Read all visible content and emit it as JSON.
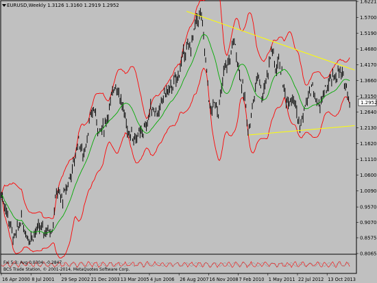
{
  "header": {
    "symbol_label": "EURUSD,Weekly",
    "ohlc_text": "1.3126 1.3160 1.2919 1.2952"
  },
  "indicator_label": "Fxi 5,3: Avg 0.0304: -0.2847",
  "copyright": "BCS Trade Station, © 2001-2014, MetaQuotes Software Corp.",
  "colors": {
    "background": "#c0c0c0",
    "candles": "#000000",
    "bands": "#ff0000",
    "ma": "#00aa00",
    "trendlines": "#ffff00",
    "price_box": "#ffffff"
  },
  "chart_data": {
    "type": "line",
    "ylim": [
      0.8065,
      1.6221
    ],
    "y_ticks": [
      "1.6221",
      "1.5700",
      "1.5190",
      "1.4680",
      "1.4170",
      "1.3660",
      "1.3150",
      "1.2640",
      "1.2130",
      "1.1620",
      "1.1110",
      "1.0600",
      "1.0090",
      "0.9570",
      "0.9070",
      "0.8575",
      "0.8065"
    ],
    "x_labels": [
      "16 Apr 2000",
      "8 Jul 2001",
      "29 Sep 2002",
      "21 Dec 2003",
      "13 Mar 2005",
      "4 Jun 2006",
      "26 Aug 2007",
      "16 Nov 2008",
      "7 Feb 2010",
      "1 May 2011",
      "22 Jul 2012",
      "13 Oct 2013"
    ],
    "current_price": "1.2952",
    "price_path": [
      [
        2000.29,
        1.0
      ],
      [
        2000.55,
        0.93
      ],
      [
        2000.82,
        0.85
      ],
      [
        2001.1,
        0.92
      ],
      [
        2001.35,
        0.86
      ],
      [
        2001.52,
        0.86
      ],
      [
        2001.85,
        0.89
      ],
      [
        2002.1,
        0.88
      ],
      [
        2002.4,
        0.89
      ],
      [
        2002.55,
        1.01
      ],
      [
        2002.8,
        0.98
      ],
      [
        2002.97,
        1.02
      ],
      [
        2003.25,
        1.09
      ],
      [
        2003.45,
        1.18
      ],
      [
        2003.65,
        1.12
      ],
      [
        2003.85,
        1.2
      ],
      [
        2003.97,
        1.25
      ],
      [
        2004.1,
        1.28
      ],
      [
        2004.3,
        1.2
      ],
      [
        2004.55,
        1.22
      ],
      [
        2004.8,
        1.3
      ],
      [
        2004.95,
        1.36
      ],
      [
        2005.15,
        1.32
      ],
      [
        2005.5,
        1.2
      ],
      [
        2005.85,
        1.18
      ],
      [
        2006.2,
        1.21
      ],
      [
        2006.45,
        1.28
      ],
      [
        2006.8,
        1.26
      ],
      [
        2006.95,
        1.32
      ],
      [
        2007.25,
        1.34
      ],
      [
        2007.55,
        1.38
      ],
      [
        2007.8,
        1.46
      ],
      [
        2008.1,
        1.48
      ],
      [
        2008.3,
        1.56
      ],
      [
        2008.5,
        1.58
      ],
      [
        2008.72,
        1.4
      ],
      [
        2008.88,
        1.26
      ],
      [
        2009.1,
        1.3
      ],
      [
        2009.2,
        1.26
      ],
      [
        2009.45,
        1.4
      ],
      [
        2009.65,
        1.43
      ],
      [
        2009.85,
        1.5
      ],
      [
        2010.1,
        1.38
      ],
      [
        2010.3,
        1.3
      ],
      [
        2010.45,
        1.2
      ],
      [
        2010.6,
        1.28
      ],
      [
        2010.85,
        1.4
      ],
      [
        2011.0,
        1.31
      ],
      [
        2011.3,
        1.42
      ],
      [
        2011.4,
        1.48
      ],
      [
        2011.55,
        1.4
      ],
      [
        2011.7,
        1.44
      ],
      [
        2011.9,
        1.34
      ],
      [
        2012.0,
        1.3
      ],
      [
        2012.3,
        1.32
      ],
      [
        2012.55,
        1.21
      ],
      [
        2012.8,
        1.29
      ],
      [
        2013.05,
        1.35
      ],
      [
        2013.3,
        1.28
      ],
      [
        2013.55,
        1.32
      ],
      [
        2013.85,
        1.37
      ],
      [
        2014.0,
        1.38
      ],
      [
        2014.2,
        1.39
      ],
      [
        2014.35,
        1.37
      ],
      [
        2014.5,
        1.34
      ],
      [
        2014.6,
        1.295
      ]
    ],
    "trendlines": [
      {
        "from": [
          2007.9,
          1.59
        ],
        "to": [
          2014.8,
          1.4
        ]
      },
      {
        "from": [
          2010.45,
          1.19
        ],
        "to": [
          2014.8,
          1.22
        ]
      }
    ]
  }
}
